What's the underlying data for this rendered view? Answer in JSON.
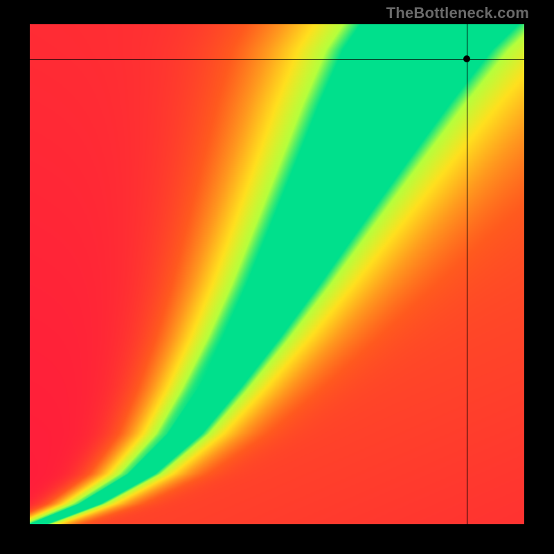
{
  "watermark": "TheBottleneck.com",
  "chart_data": {
    "type": "heatmap",
    "title": "",
    "xlabel": "",
    "ylabel": "",
    "xlim": [
      0,
      1
    ],
    "ylim": [
      0,
      1
    ],
    "color_scale": {
      "description": "smooth gradient red→orange→yellow→green, green band along a curved ridge",
      "stops": [
        {
          "t": 0.0,
          "color": "#ff1a3c"
        },
        {
          "t": 0.35,
          "color": "#ff5a1e"
        },
        {
          "t": 0.55,
          "color": "#ff9a1e"
        },
        {
          "t": 0.75,
          "color": "#ffe01e"
        },
        {
          "t": 0.92,
          "color": "#b6ff3c"
        },
        {
          "t": 1.0,
          "color": "#00e08c"
        }
      ]
    },
    "ridge_curve_xy": [
      [
        0.0,
        0.0
      ],
      [
        0.1,
        0.04
      ],
      [
        0.2,
        0.1
      ],
      [
        0.28,
        0.18
      ],
      [
        0.34,
        0.27
      ],
      [
        0.4,
        0.37
      ],
      [
        0.46,
        0.48
      ],
      [
        0.52,
        0.6
      ],
      [
        0.58,
        0.72
      ],
      [
        0.64,
        0.84
      ],
      [
        0.7,
        0.95
      ],
      [
        0.74,
        1.0
      ]
    ],
    "ridge_width_fraction": 0.035,
    "crosshair": {
      "x": 0.885,
      "y": 0.93
    },
    "marker": {
      "x": 0.885,
      "y": 0.93
    }
  }
}
